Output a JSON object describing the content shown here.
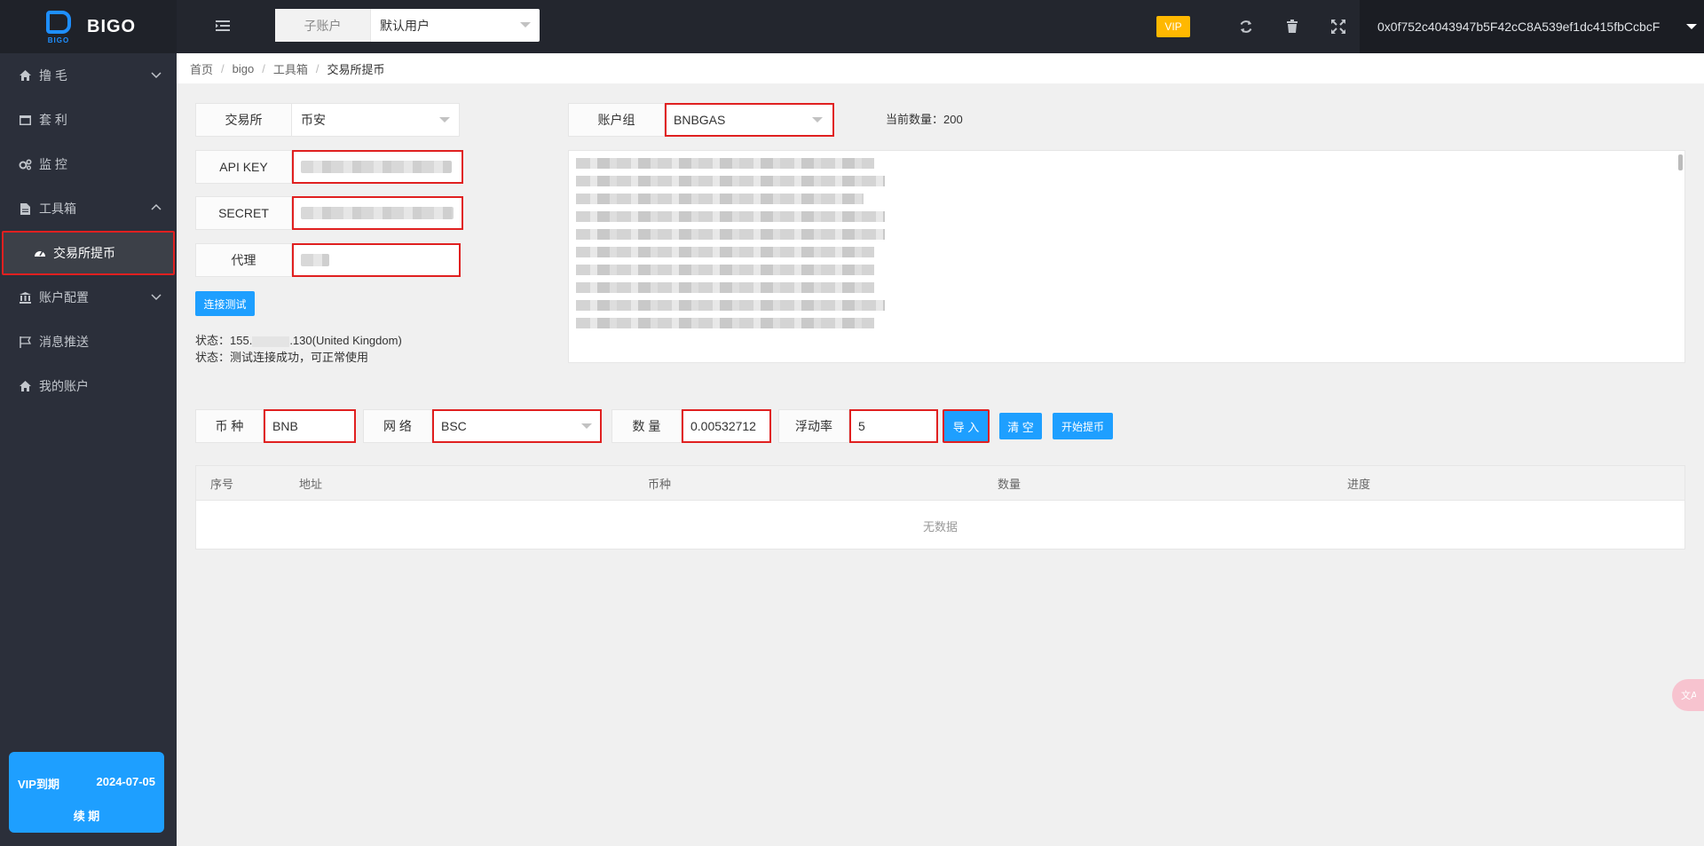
{
  "brand": {
    "logo_text": "BIGO",
    "logo_sub": "BIGO"
  },
  "sidebar": {
    "items": [
      {
        "label": "撸 毛",
        "icon": "home-icon",
        "expandable": true,
        "expanded": false
      },
      {
        "label": "套 利",
        "icon": "window-icon",
        "expandable": false
      },
      {
        "label": "监 控",
        "icon": "gears-icon",
        "expandable": false
      },
      {
        "label": "工具箱",
        "icon": "file-icon",
        "expandable": true,
        "expanded": true
      },
      {
        "label": "账户配置",
        "icon": "bank-icon",
        "expandable": true,
        "expanded": false
      },
      {
        "label": "消息推送",
        "icon": "flag-icon",
        "expandable": false
      },
      {
        "label": "我的账户",
        "icon": "home-icon",
        "expandable": false
      }
    ],
    "active_sub": {
      "label": "交易所提币",
      "icon": "dashboard-icon"
    },
    "vip_card": {
      "label": "VIP到期",
      "date": "2024-07-05",
      "renew": "续 期"
    }
  },
  "topbar": {
    "account_label": "子账户",
    "account_value": "默认用户",
    "vip": "VIP",
    "wallet": "0x0f752c4043947b5F42cC8A539ef1dc415fbCcbcF",
    "icons": [
      "refresh-icon",
      "trash-icon",
      "fullscreen-icon"
    ]
  },
  "breadcrumb": [
    "首页",
    "bigo",
    "工具箱",
    "交易所提币"
  ],
  "form": {
    "exchange_label": "交易所",
    "exchange_value": "币安",
    "apikey_label": "API KEY",
    "secret_label": "SECRET",
    "proxy_label": "代理",
    "test_button": "连接测试",
    "status_line1_prefix": "状态：155.",
    "status_line1_suffix": ".130(United Kingdom)",
    "status_line2": "状态：测试连接成功，可正常使用",
    "group_label": "账户组",
    "group_value": "BNBGAS",
    "count_text": "当前数量：200"
  },
  "withdraw": {
    "coin_label": "币 种",
    "coin_value": "BNB",
    "network_label": "网 络",
    "network_value": "BSC",
    "amount_label": "数 量",
    "amount_value": "0.00532712",
    "float_label": "浮动率",
    "float_value": "5",
    "import_button": "导 入",
    "clear_button": "清 空",
    "start_button": "开始提币"
  },
  "table": {
    "headers": [
      "序号",
      "地址",
      "币种",
      "数量",
      "进度"
    ],
    "empty_text": "无数据"
  },
  "colors": {
    "accent": "#1e9fff",
    "vip": "#ffb800",
    "highlight": "#e02020",
    "sidebar": "#2b2f3a"
  }
}
